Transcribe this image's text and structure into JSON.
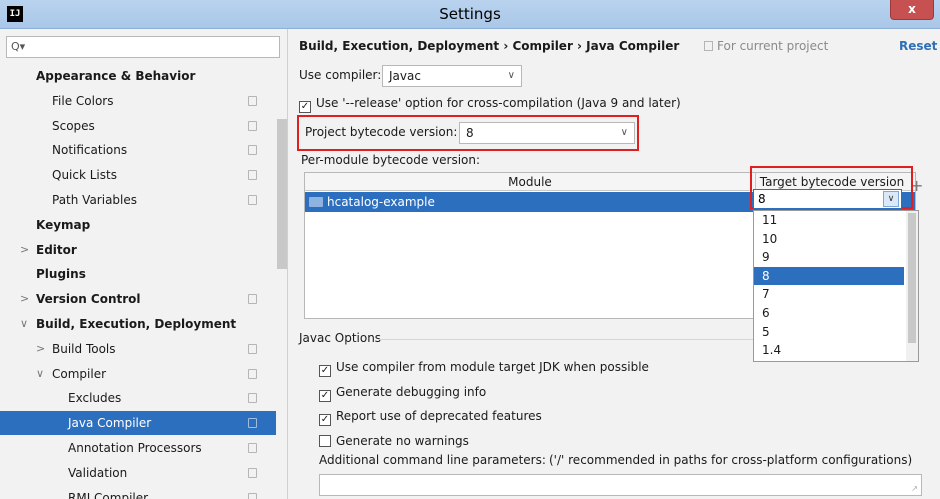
{
  "window": {
    "title": "Settings",
    "app_icon": "IJ",
    "close_label": "x"
  },
  "sidebar": {
    "search": {
      "placeholder": "Q▾",
      "icon": "search-icon"
    },
    "items": [
      {
        "label": "Appearance & Behavior",
        "bold": true,
        "indent": 0
      },
      {
        "label": "File Colors",
        "indent": 1
      },
      {
        "label": "Scopes",
        "indent": 1
      },
      {
        "label": "Notifications",
        "indent": 1
      },
      {
        "label": "Quick Lists",
        "indent": 1
      },
      {
        "label": "Path Variables",
        "indent": 1
      },
      {
        "label": "Keymap",
        "bold": true,
        "indent": 0
      },
      {
        "label": "Editor",
        "bold": true,
        "indent": 0,
        "arrow": ">"
      },
      {
        "label": "Plugins",
        "bold": true,
        "indent": 0
      },
      {
        "label": "Version Control",
        "bold": true,
        "indent": 0,
        "arrow": ">"
      },
      {
        "label": "Build, Execution, Deployment",
        "bold": true,
        "indent": 0,
        "arrow": "∨"
      },
      {
        "label": "Build Tools",
        "indent": 1,
        "arrow": ">"
      },
      {
        "label": "Compiler",
        "indent": 1,
        "arrow": "∨"
      },
      {
        "label": "Excludes",
        "indent": 2
      },
      {
        "label": "Java Compiler",
        "indent": 2,
        "selected": true
      },
      {
        "label": "Annotation Processors",
        "indent": 2
      },
      {
        "label": "Validation",
        "indent": 2
      },
      {
        "label": "RMI Compiler",
        "indent": 2
      }
    ]
  },
  "breadcrumb": {
    "text": "Build, Execution, Deployment  ›  Compiler  ›  Java Compiler",
    "for_project": "For current project",
    "reset": "Reset"
  },
  "compiler": {
    "use_compiler_label": "Use compiler:",
    "use_compiler_value": "Javac",
    "release_option": "Use '--release' option for cross-compilation (Java 9 and later)",
    "project_bytecode_label": "Project bytecode version:",
    "project_bytecode_value": "8",
    "per_module_label": "Per-module bytecode version:"
  },
  "module_table": {
    "headers": [
      "Module",
      "Target bytecode version"
    ],
    "rows": [
      {
        "module": "hcatalog-example",
        "target": "8"
      }
    ],
    "add_label": "+"
  },
  "target_dropdown": {
    "options": [
      "11",
      "10",
      "9",
      "8",
      "7",
      "6",
      "5",
      "1.4"
    ],
    "selected": "8"
  },
  "javac": {
    "section_title": "Javac Options",
    "options": [
      {
        "label": "Use compiler from module target JDK when possible",
        "checked": true
      },
      {
        "label": "Generate debugging info",
        "checked": true
      },
      {
        "label": "Report use of deprecated features",
        "checked": true
      },
      {
        "label": "Generate no warnings",
        "checked": false
      }
    ],
    "additional_label": "Additional command line parameters:",
    "additional_hint": "('/' recommended in paths for cross-platform configurations)",
    "additional_value": ""
  },
  "colors": {
    "selection": "#2d6fbf",
    "highlight_box": "#e02020",
    "link": "#2f6fb6"
  }
}
